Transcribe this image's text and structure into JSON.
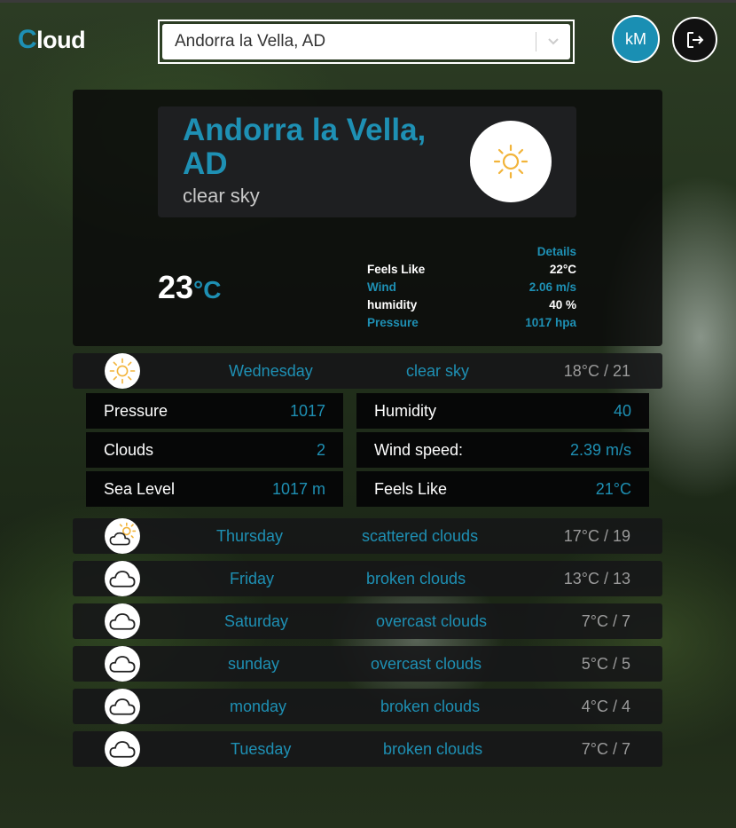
{
  "app": {
    "logo_first": "C",
    "logo_rest": "loud"
  },
  "search": {
    "selected": "Andorra la Vella, AD"
  },
  "user": {
    "initials": "kM"
  },
  "current": {
    "city": "Andorra la Vella, AD",
    "description": "clear sky",
    "temp": "23",
    "unit": "°C",
    "details_title": "Details",
    "details": [
      {
        "label": "Feels Like",
        "value": "22°C"
      },
      {
        "label": "Wind",
        "value": "2.06 m/s"
      },
      {
        "label": "humidity",
        "value": "40 %"
      },
      {
        "label": "Pressure",
        "value": "1017 hpa"
      }
    ]
  },
  "forecast": [
    {
      "day": "Wednesday",
      "desc": "clear sky",
      "temp": "18°C / 21",
      "icon": "sun-icon"
    },
    {
      "day": "Thursday",
      "desc": "scattered clouds",
      "temp": "17°C / 19",
      "icon": "sun-cloud-icon"
    },
    {
      "day": "Friday",
      "desc": "broken clouds",
      "temp": "13°C / 13",
      "icon": "cloud-icon"
    },
    {
      "day": "Saturday",
      "desc": "overcast clouds",
      "temp": "7°C / 7",
      "icon": "cloud-icon"
    },
    {
      "day": "sunday",
      "desc": "overcast clouds",
      "temp": "5°C / 5",
      "icon": "cloud-icon"
    },
    {
      "day": "monday",
      "desc": "broken clouds",
      "temp": "4°C / 4",
      "icon": "cloud-icon"
    },
    {
      "day": "Tuesday",
      "desc": "broken clouds",
      "temp": "7°C / 7",
      "icon": "cloud-icon"
    }
  ],
  "expanded": {
    "stats": [
      {
        "label": "Pressure",
        "value": "1017"
      },
      {
        "label": "Humidity",
        "value": "40"
      },
      {
        "label": "Clouds",
        "value": "2"
      },
      {
        "label": "Wind speed:",
        "value": "2.39 m/s"
      },
      {
        "label": "Sea Level",
        "value": "1017 m"
      },
      {
        "label": "Feels Like",
        "value": "21°C"
      }
    ]
  },
  "colors": {
    "accent": "#1e90b4",
    "sun": "#f2b43a"
  }
}
